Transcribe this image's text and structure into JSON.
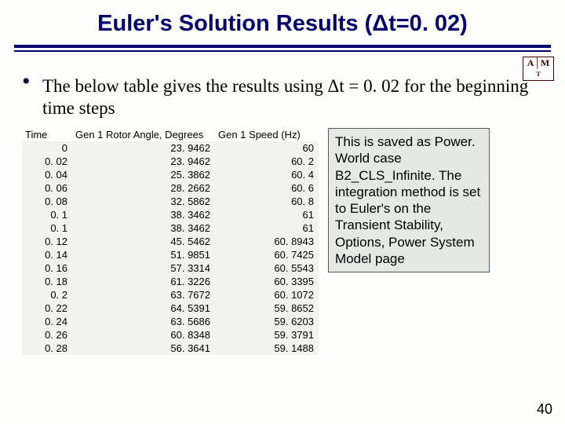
{
  "title": "Euler's Solution Results (Δt=0. 02)",
  "bullet": "The below table gives the results using Δt = 0. 02 for the beginning time steps",
  "logo": "A|M\nT",
  "sidebox": "This is saved as Power. World case B2_CLS_Infinite. The integration method is set to Euler's on the Transient Stability, Options, Power System Model page",
  "page_number": "40",
  "chart_data": {
    "type": "table",
    "columns": [
      "Time",
      "Gen 1 Rotor Angle, Degrees",
      "Gen 1 Speed (Hz)"
    ],
    "rows": [
      [
        "0",
        "23. 9462",
        "60"
      ],
      [
        "0. 02",
        "23. 9462",
        "60. 2"
      ],
      [
        "0. 04",
        "25. 3862",
        "60. 4"
      ],
      [
        "0. 06",
        "28. 2662",
        "60. 6"
      ],
      [
        "0. 08",
        "32. 5862",
        "60. 8"
      ],
      [
        "0. 1",
        "38. 3462",
        "61"
      ],
      [
        "0. 1",
        "38. 3462",
        "61"
      ],
      [
        "0. 12",
        "45. 5462",
        "60. 8943"
      ],
      [
        "0. 14",
        "51. 9851",
        "60. 7425"
      ],
      [
        "0. 16",
        "57. 3314",
        "60. 5543"
      ],
      [
        "0. 18",
        "61. 3226",
        "60. 3395"
      ],
      [
        "0. 2",
        "63. 7672",
        "60. 1072"
      ],
      [
        "0. 22",
        "64. 5391",
        "59. 8652"
      ],
      [
        "0. 24",
        "63. 5686",
        "59. 6203"
      ],
      [
        "0. 26",
        "60. 8348",
        "59. 3791"
      ],
      [
        "0. 28",
        "56. 3641",
        "59. 1488"
      ]
    ]
  }
}
